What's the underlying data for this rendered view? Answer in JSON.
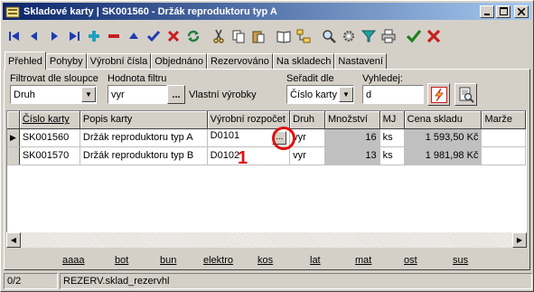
{
  "window": {
    "title": "Skladové karty | SK001560 - Držák reproduktoru typ A",
    "minimize": "_",
    "maximize": "□",
    "close": "×"
  },
  "tabs": [
    {
      "label": "Přehled",
      "active": true
    },
    {
      "label": "Pohyby"
    },
    {
      "label": "Výrobní čísla"
    },
    {
      "label": "Objednáno"
    },
    {
      "label": "Rezervováno"
    },
    {
      "label": "Na skladech"
    },
    {
      "label": "Nastavení"
    }
  ],
  "filters": {
    "filter_column_label": "Filtrovat dle sloupce",
    "filter_column_value": "Druh",
    "filter_value_label": "Hodnota filtru",
    "filter_value": "vyr",
    "filter_value_desc": "Vlastní výrobky",
    "sort_label": "Seřadit dle",
    "sort_value": "Číslo karty",
    "search_label": "Vyhledej:",
    "search_value": "d",
    "dots": "..."
  },
  "table": {
    "columns": [
      "Číslo karty",
      "Popis karty",
      "Výrobní rozpočet",
      "Druh",
      "Množství",
      "MJ",
      "Cena skladu",
      "Marže"
    ],
    "rows": [
      {
        "cislo": "SK001560",
        "popis": "Držák reproduktoru typ A",
        "rozpocet": "D0101",
        "druh": "vyr",
        "mnozstvi": "16",
        "mj": "ks",
        "cena": "1 593,50 Kč",
        "marze": "",
        "current": true
      },
      {
        "cislo": "SK001570",
        "popis": "Držák reproduktoru typ B",
        "rozpocet": "D0102",
        "druh": "vyr",
        "mnozstvi": "13",
        "mj": "ks",
        "cena": "1 981,98 Kč",
        "marze": ""
      }
    ],
    "cell_button": "..."
  },
  "category_links": [
    "aaaa",
    "bot",
    "bun",
    "elektro",
    "kos",
    "lat",
    "mat",
    "ost",
    "sus"
  ],
  "status": {
    "record": "0/2",
    "source": "REZERV.sklad_rezervhl"
  },
  "annotation": {
    "number": "1",
    "color": "#e01010"
  },
  "colors": {
    "titlebar_start": "#0a246a",
    "titlebar_end": "#a6caf0",
    "face": "#d4d0c8"
  },
  "toolbar_icons": [
    "first-record-icon",
    "prev-record-icon",
    "next-record-icon",
    "last-record-icon",
    "add-icon",
    "delete-icon",
    "up-icon",
    "confirm-icon",
    "cancel-edit-icon",
    "refresh-icon",
    "cut-icon",
    "copy-icon",
    "paste-icon",
    "book-icon",
    "tree-icon",
    "search-icon",
    "settings-icon",
    "filter-icon",
    "print-icon",
    "ok-icon",
    "close-icon"
  ]
}
